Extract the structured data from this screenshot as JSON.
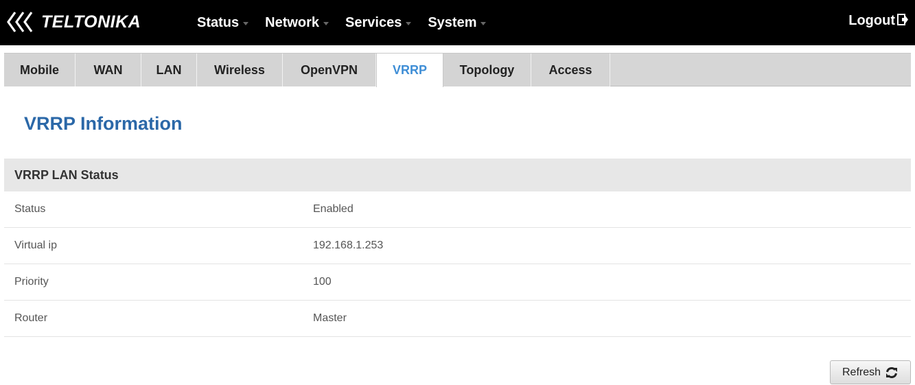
{
  "header": {
    "brand": "TELTONIKA",
    "nav": [
      {
        "label": "Status"
      },
      {
        "label": "Network"
      },
      {
        "label": "Services"
      },
      {
        "label": "System"
      }
    ],
    "logout_label": "Logout"
  },
  "tabs": [
    {
      "label": "Mobile"
    },
    {
      "label": "WAN"
    },
    {
      "label": "LAN"
    },
    {
      "label": "Wireless"
    },
    {
      "label": "OpenVPN"
    },
    {
      "label": "VRRP",
      "active": true
    },
    {
      "label": "Topology"
    },
    {
      "label": "Access"
    }
  ],
  "page": {
    "title": "VRRP Information",
    "section_title": "VRRP LAN Status",
    "rows": [
      {
        "label": "Status",
        "value": "Enabled"
      },
      {
        "label": "Virtual ip",
        "value": "192.168.1.253"
      },
      {
        "label": "Priority",
        "value": "100"
      },
      {
        "label": "Router",
        "value": "Master"
      }
    ],
    "refresh_label": "Refresh"
  },
  "colors": {
    "topbar": "#000000",
    "active_tab_text": "#3f8ed6",
    "title": "#2b68a8"
  },
  "icons": {
    "logo": "teltonika-chevrons-icon",
    "logout": "logout-exit-icon",
    "refresh": "refresh-arrows-icon",
    "menu_caret": "chevron-down-icon"
  }
}
